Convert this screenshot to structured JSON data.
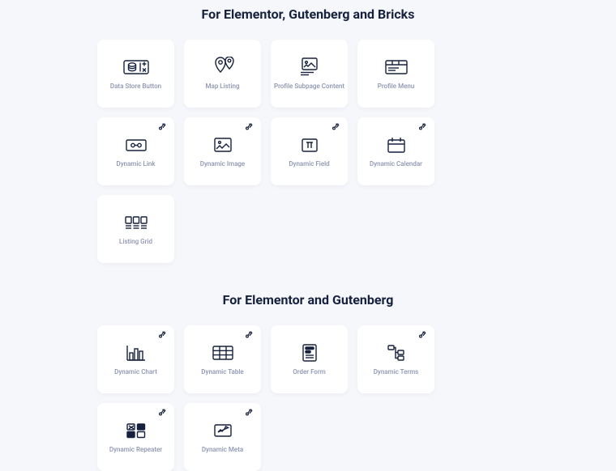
{
  "sections": [
    {
      "title": "For Elementor, Gutenberg and Bricks",
      "items": [
        {
          "label": "Data Store Button",
          "icon": "data-store",
          "badge": false
        },
        {
          "label": "Map Listing",
          "icon": "map-pin",
          "badge": false
        },
        {
          "label": "Profile Subpage Content",
          "icon": "profile-content",
          "badge": false
        },
        {
          "label": "Profile Menu",
          "icon": "profile-menu",
          "badge": false
        },
        {
          "label": "Dynamic Link",
          "icon": "link",
          "badge": true
        },
        {
          "label": "Dynamic Image",
          "icon": "image",
          "badge": true
        },
        {
          "label": "Dynamic Field",
          "icon": "field",
          "badge": true
        },
        {
          "label": "Dynamic Calendar",
          "icon": "calendar",
          "badge": true
        },
        {
          "label": "Listing Grid",
          "icon": "grid",
          "badge": false
        }
      ]
    },
    {
      "title": "For Elementor and Gutenberg",
      "items": [
        {
          "label": "Dynamic Chart",
          "icon": "chart",
          "badge": true
        },
        {
          "label": "Dynamic Table",
          "icon": "table",
          "badge": true
        },
        {
          "label": "Order Form",
          "icon": "form",
          "badge": false
        },
        {
          "label": "Dynamic Terms",
          "icon": "terms",
          "badge": true
        },
        {
          "label": "Dynamic Repeater",
          "icon": "repeater",
          "badge": true
        },
        {
          "label": "Dynamic Meta",
          "icon": "meta",
          "badge": true
        }
      ]
    }
  ]
}
